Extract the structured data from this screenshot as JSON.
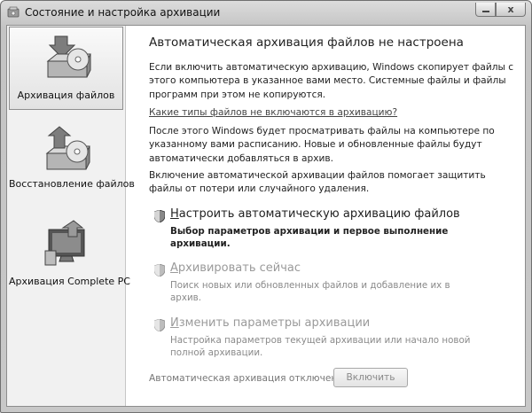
{
  "window": {
    "title": "Состояние и настройка архивации",
    "close_glyph": "x"
  },
  "sidebar": {
    "items": [
      {
        "label": "Архивация файлов",
        "icon": "file-backup-icon",
        "active": true
      },
      {
        "label": "Восстановление файлов",
        "icon": "file-restore-icon",
        "active": false
      },
      {
        "label": "Архивация Complete PC",
        "icon": "complete-pc-backup-icon",
        "active": false
      }
    ]
  },
  "main": {
    "heading": "Автоматическая архивация файлов не настроена",
    "intro": "Если включить автоматическую архивацию, Windows скопирует файлы с этого компьютера в указанное вами место. Системные файлы и файлы программ при этом не копируются.",
    "link": "Какие типы файлов не включаются в архивацию?",
    "info1": "После этого Windows будет просматривать файлы на компьютере по указанному вами расписанию. Новые и обновленные файлы будут автоматически добавляться в архив.",
    "info2": "Включение автоматической архивации файлов помогает защитить файлы от потери или случайного удаления.",
    "tasks": [
      {
        "title_accel": "Н",
        "title_rest": "астроить автоматическую архивацию файлов",
        "description": "Выбор параметров архивации и первое выполнение архивации.",
        "enabled": true
      },
      {
        "title_accel": "А",
        "title_rest": "рхивировать сейчас",
        "description": "Поиск новых или обновленных файлов и добавление их в архив.",
        "enabled": false
      },
      {
        "title_accel": "И",
        "title_rest": "зменить параметры архивации",
        "description": "Настройка параметров текущей архивации или начало новой полной архивации.",
        "enabled": false
      }
    ],
    "status_text": "Автоматическая архивация отключена",
    "enable_button": "Включить"
  }
}
